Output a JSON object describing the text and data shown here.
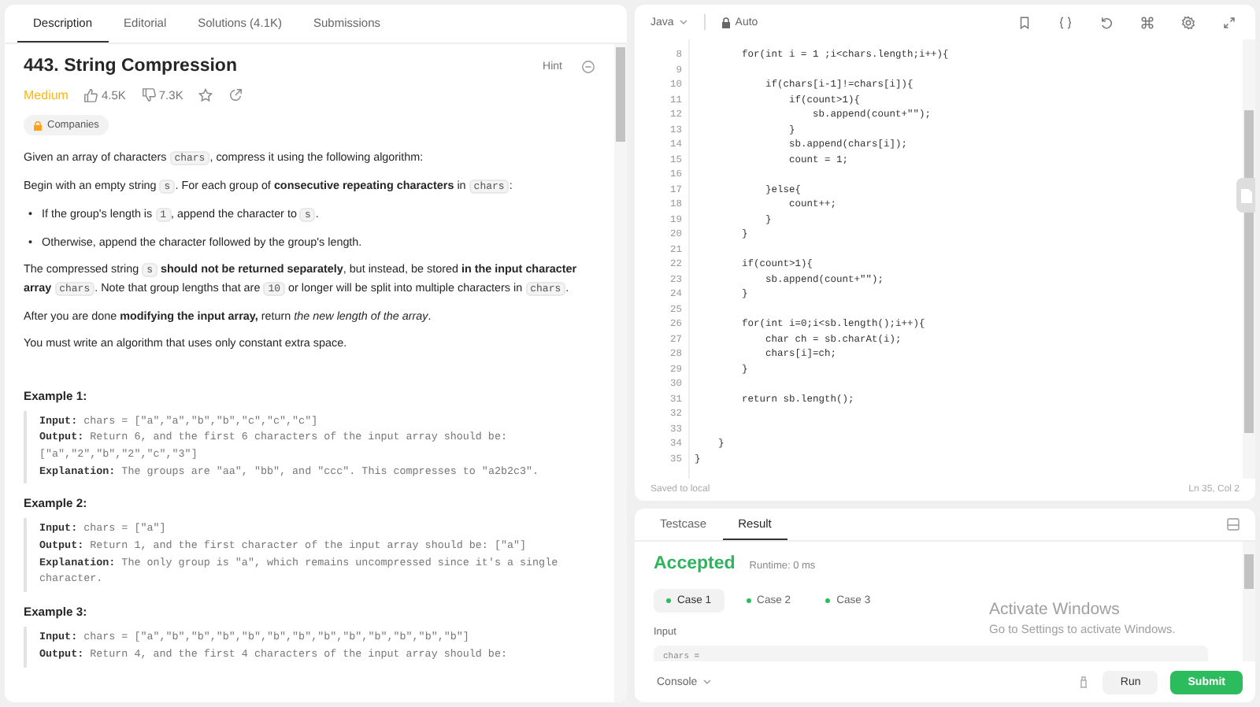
{
  "problem_tabs": [
    {
      "label": "Description",
      "selected": true
    },
    {
      "label": "Editorial",
      "selected": false
    },
    {
      "label": "Solutions (4.1K)",
      "selected": false
    },
    {
      "label": "Submissions",
      "selected": false
    }
  ],
  "title": "443. String Compression",
  "hint": "Hint",
  "difficulty": "Medium",
  "likes": "4.5K",
  "dislikes": "7.3K",
  "companies": "Companies",
  "description": [
    {
      "kind": "paragraph",
      "segments": [
        {
          "kind": "text",
          "text": "Given an array of characters "
        },
        {
          "kind": "code",
          "text": "chars"
        },
        {
          "kind": "text",
          "text": ", compress it using the following algorithm:"
        }
      ]
    },
    {
      "kind": "paragraph",
      "segments": [
        {
          "kind": "text",
          "text": "Begin with an empty string "
        },
        {
          "kind": "code",
          "text": "s"
        },
        {
          "kind": "text",
          "text": ". For each group of **consecutive repeating characters** in "
        },
        {
          "kind": "code",
          "text": "chars"
        },
        {
          "kind": "text",
          "text": ":"
        }
      ]
    },
    {
      "kind": "bullets",
      "marker": "•",
      "items": [
        [
          {
            "kind": "text",
            "text": "If the group's length is "
          },
          {
            "kind": "code",
            "text": "1"
          },
          {
            "kind": "text",
            "text": ", append the character to "
          },
          {
            "kind": "code",
            "text": "s"
          },
          {
            "kind": "text",
            "text": "."
          }
        ],
        [
          {
            "kind": "text",
            "text": "Otherwise, append the character followed by the group's length."
          }
        ]
      ]
    },
    {
      "kind": "paragraph",
      "segments": [
        {
          "kind": "text",
          "text": "The compressed string "
        },
        {
          "kind": "code",
          "text": "s"
        },
        {
          "kind": "text",
          "text": " **should not be returned separately**, but instead, be stored **in the input character array** "
        },
        {
          "kind": "code",
          "text": "chars"
        },
        {
          "kind": "text",
          "text": ". Note that group lengths that are "
        },
        {
          "kind": "code",
          "text": "10"
        },
        {
          "kind": "text",
          "text": " or longer will be split into multiple characters in "
        },
        {
          "kind": "code",
          "text": "chars"
        },
        {
          "kind": "text",
          "text": "."
        }
      ]
    },
    {
      "kind": "paragraph",
      "segments": [
        {
          "kind": "text",
          "text": "After you are done **modifying the input array,** return *the new length of the array*."
        }
      ]
    },
    {
      "kind": "paragraph",
      "segments": [
        {
          "kind": "text",
          "text": "You must write an algorithm that uses only constant extra space."
        }
      ]
    }
  ],
  "examples": [
    {
      "title": "Example 1:",
      "lines": [
        "**Input:** chars = [\"a\",\"a\",\"b\",\"b\",\"c\",\"c\",\"c\"]",
        "**Output:** Return 6, and the first 6 characters of the input array should be: [\"a\",\"2\",\"b\",\"2\",\"c\",\"3\"]",
        "**Explanation:** The groups are \"aa\", \"bb\", and \"ccc\". This compresses to \"a2b2c3\"."
      ]
    },
    {
      "title": "Example 2:",
      "lines": [
        "**Input:** chars = [\"a\"]",
        "**Output:** Return 1, and the first character of the input array should be: [\"a\"]",
        "**Explanation:** The only group is \"a\", which remains uncompressed since it's a single character."
      ]
    },
    {
      "title": "Example 3:",
      "lines": [
        "**Input:** chars = [\"a\",\"b\",\"b\",\"b\",\"b\",\"b\",\"b\",\"b\",\"b\",\"b\",\"b\",\"b\",\"b\"]",
        "**Output:** Return 4, and the first 4 characters of the input array should be:"
      ]
    }
  ],
  "editor": {
    "language": "Java",
    "mode": "Auto",
    "lines": [
      {
        "number": "8",
        "text": "        for(int i = 1 ;i<chars.length;i++){"
      },
      {
        "number": "9"
      },
      {
        "number": "10",
        "text": "            if(chars[i-1]!=chars[i]){"
      },
      {
        "number": "11",
        "text": "                if(count>1){"
      },
      {
        "number": "12",
        "text": "                    sb.append(count+\"\");"
      },
      {
        "number": "13",
        "text": "                }"
      },
      {
        "number": "14",
        "text": "                sb.append(chars[i]);"
      },
      {
        "number": "15",
        "text": "                count = 1;"
      },
      {
        "number": "16"
      },
      {
        "number": "17",
        "text": "            }else{"
      },
      {
        "number": "18",
        "text": "                count++;"
      },
      {
        "number": "19",
        "text": "            }"
      },
      {
        "number": "20",
        "text": "        }"
      },
      {
        "number": "21"
      },
      {
        "number": "22",
        "text": "        if(count>1){"
      },
      {
        "number": "23",
        "text": "            sb.append(count+\"\");"
      },
      {
        "number": "24",
        "text": "        }"
      },
      {
        "number": "25"
      },
      {
        "number": "26",
        "text": "        for(int i=0;i<sb.length();i++){"
      },
      {
        "number": "27",
        "text": "            char ch = sb.charAt(i);"
      },
      {
        "number": "28",
        "text": "            chars[i]=ch;"
      },
      {
        "number": "29",
        "text": "        }"
      },
      {
        "number": "30"
      },
      {
        "number": "31",
        "text": "        return sb.length();"
      },
      {
        "number": "32"
      },
      {
        "number": "33"
      },
      {
        "number": "34",
        "text": "    }"
      },
      {
        "number": "35",
        "text": "}"
      }
    ],
    "saved": "Saved to local",
    "cursor": "Ln 35, Col 2"
  },
  "result_tabs": [
    {
      "label": "Testcase",
      "selected": false
    },
    {
      "label": "Result",
      "selected": true
    }
  ],
  "status": "Accepted",
  "runtime": "Runtime: 0 ms",
  "cases": [
    {
      "label": "Case 1",
      "selected": true
    },
    {
      "label": "Case 2",
      "selected": false
    },
    {
      "label": "Case 3",
      "selected": false
    }
  ],
  "input_label": "Input",
  "input_value": "chars =",
  "console": "Console",
  "run": "Run",
  "submit": "Submit",
  "os_notice": {
    "title": "Activate Windows",
    "text": "Go to Settings to activate Windows."
  }
}
